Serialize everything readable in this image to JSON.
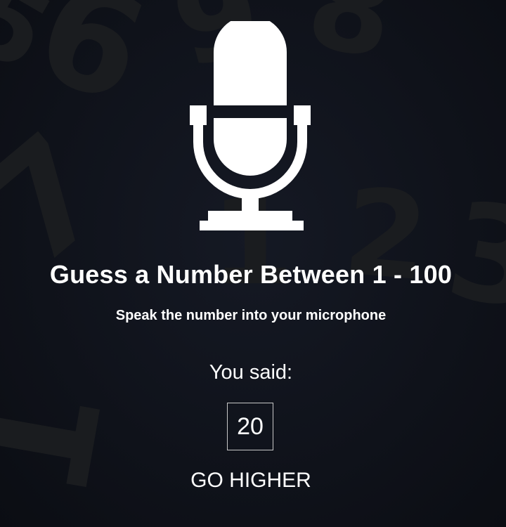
{
  "game": {
    "title": "Guess a Number Between 1 - 100",
    "instruction": "Speak the number into your microphone",
    "you_said_label": "You said:",
    "spoken_number": "20",
    "hint": "GO HIGHER"
  },
  "icons": {
    "main_icon": "microphone-icon"
  },
  "colors": {
    "background": "#10131c",
    "text": "#ffffff",
    "box_border": "#c8c8c8"
  }
}
